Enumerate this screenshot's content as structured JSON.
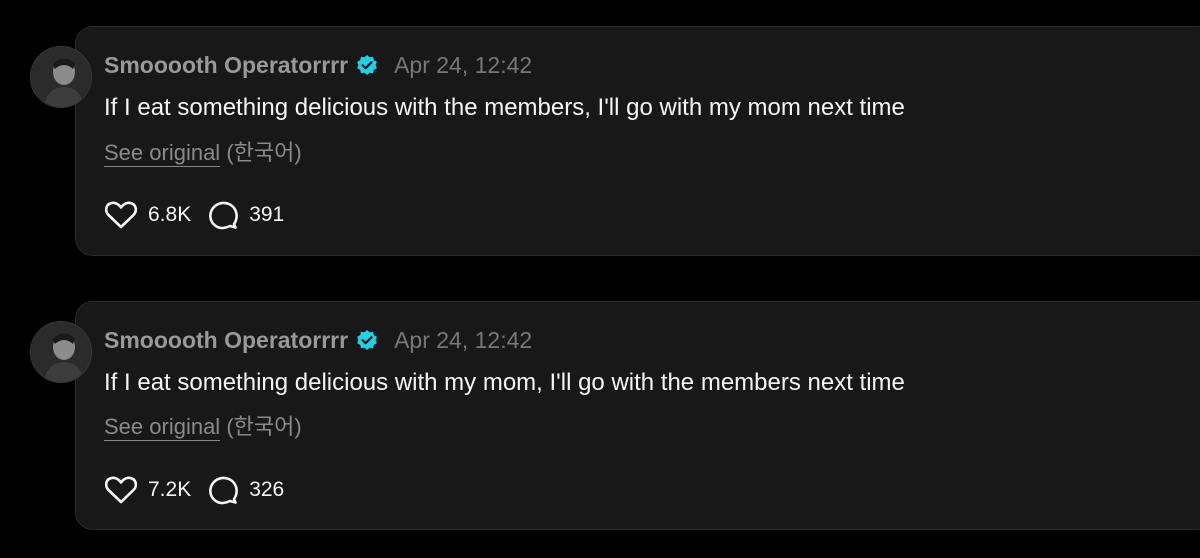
{
  "posts": [
    {
      "username": "Smooooth Operatorrrr",
      "timestamp": "Apr 24, 12:42",
      "text": "If I eat something delicious with the members, I'll go with my mom next time",
      "see_original": "See original",
      "original_language": "(한국어)",
      "likes": "6.8K",
      "replies": "391"
    },
    {
      "username": "Smooooth Operatorrrr",
      "timestamp": "Apr 24, 12:42",
      "text": "If I eat something delicious with my mom, I'll go with the members next time",
      "see_original": "See original",
      "original_language": "(한국어)",
      "likes": "7.2K",
      "replies": "326"
    }
  ],
  "icons": {
    "verified": "verified-badge-icon",
    "like": "heart-icon",
    "reply": "speech-bubble-icon"
  },
  "colors": {
    "background": "#000000",
    "card": "#181818",
    "verified": "#1fd1e6",
    "text": "#f3f5f7",
    "muted": "#8a8a8a"
  }
}
